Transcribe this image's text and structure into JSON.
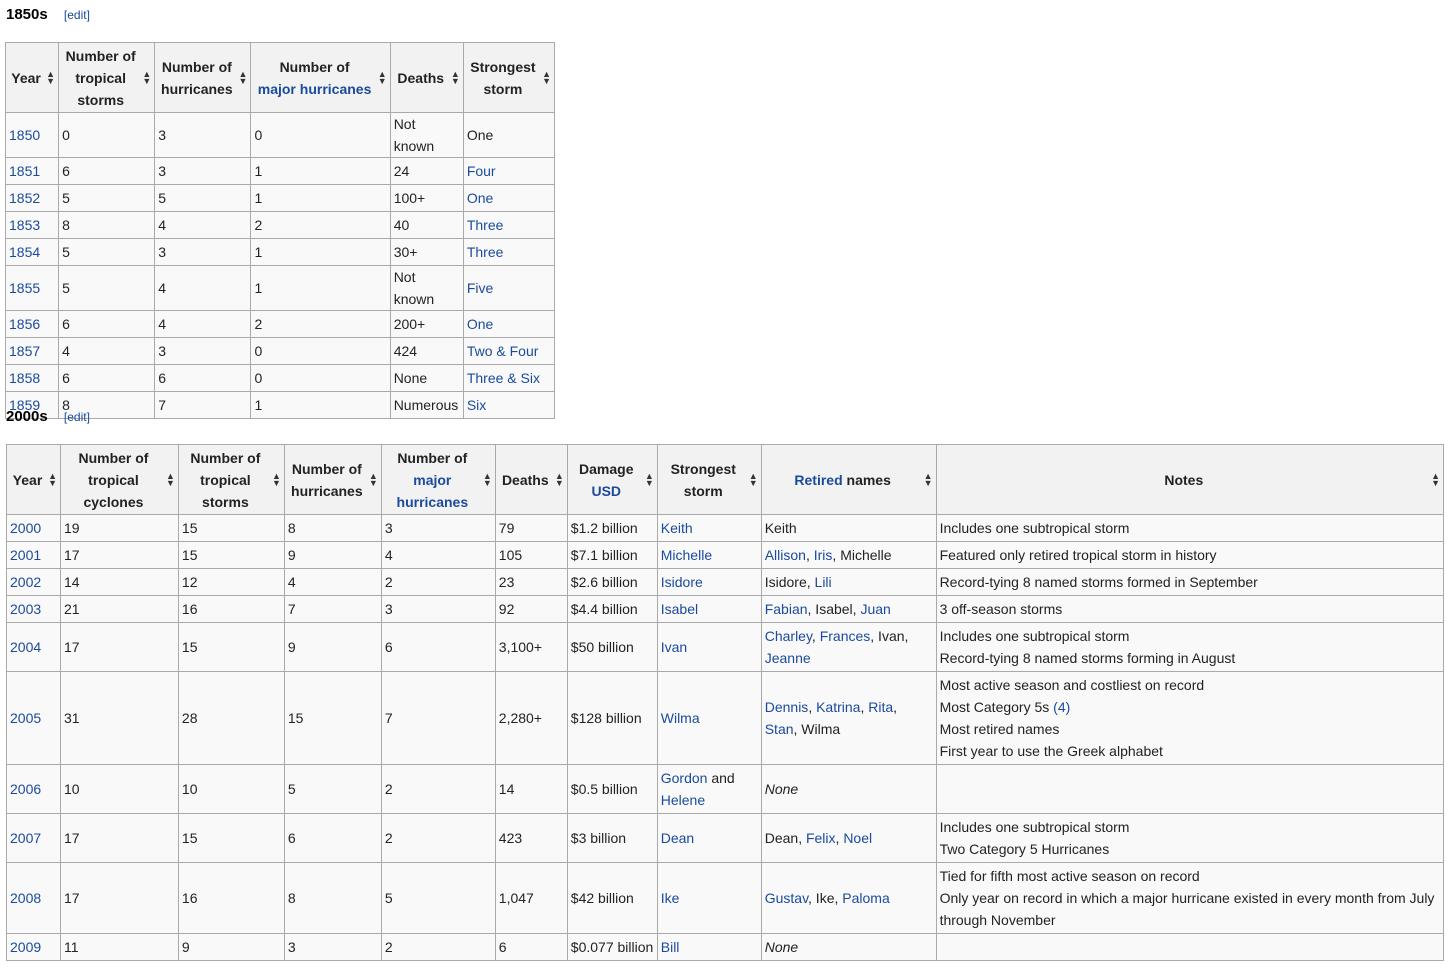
{
  "s1850": {
    "title": "1850s",
    "edit": "[edit]",
    "headers": [
      {
        "text": "Year"
      },
      {
        "text": "Number of tropical storms"
      },
      {
        "text": "Number of hurricanes"
      },
      {
        "pre": "Number of",
        "link": "major hurricanes"
      },
      {
        "text": "Deaths"
      },
      {
        "text": "Strongest storm"
      }
    ],
    "rows": [
      {
        "year": "1850",
        "ts": "0",
        "hu": "3",
        "mh": "0",
        "deaths": "Not known",
        "strongest": "One",
        "strongest_link": false
      },
      {
        "year": "1851",
        "ts": "6",
        "hu": "3",
        "mh": "1",
        "deaths": "24",
        "strongest": "Four",
        "strongest_link": true
      },
      {
        "year": "1852",
        "ts": "5",
        "hu": "5",
        "mh": "1",
        "deaths": "100+",
        "strongest": "One",
        "strongest_link": true
      },
      {
        "year": "1853",
        "ts": "8",
        "hu": "4",
        "mh": "2",
        "deaths": "40",
        "strongest": "Three",
        "strongest_link": true
      },
      {
        "year": "1854",
        "ts": "5",
        "hu": "3",
        "mh": "1",
        "deaths": "30+",
        "strongest": "Three",
        "strongest_link": true
      },
      {
        "year": "1855",
        "ts": "5",
        "hu": "4",
        "mh": "1",
        "deaths": "Not known",
        "strongest": "Five",
        "strongest_link": true
      },
      {
        "year": "1856",
        "ts": "6",
        "hu": "4",
        "mh": "2",
        "deaths": "200+",
        "strongest": "One",
        "strongest_link": true
      },
      {
        "year": "1857",
        "ts": "4",
        "hu": "3",
        "mh": "0",
        "deaths": "424",
        "strongest": "Two & Four",
        "strongest_link": true
      },
      {
        "year": "1858",
        "ts": "6",
        "hu": "6",
        "mh": "0",
        "deaths": "None",
        "strongest": "Three & Six",
        "strongest_link": true
      },
      {
        "year": "1859",
        "ts": "8",
        "hu": "7",
        "mh": "1",
        "deaths": "Numerous",
        "strongest": "Six",
        "strongest_link": true
      }
    ]
  },
  "s2000": {
    "title": "2000s",
    "edit": "[edit]",
    "headers": [
      {
        "text": "Year"
      },
      {
        "text": "Number of tropical cyclones"
      },
      {
        "text": "Number of tropical storms"
      },
      {
        "text": "Number of hurricanes"
      },
      {
        "pre": "Number of",
        "link": "major hurricanes"
      },
      {
        "text": "Deaths"
      },
      {
        "pre": "Damage",
        "link": "USD"
      },
      {
        "text": "Strongest storm"
      },
      {
        "link": "Retired",
        "post": " names"
      },
      {
        "text": "Notes"
      }
    ],
    "rows": [
      {
        "year": "2000",
        "tc": "19",
        "ts": "15",
        "hu": "8",
        "mh": "3",
        "deaths": "79",
        "damage": "$1.2 billion",
        "strongest": [
          {
            "t": "Keith",
            "l": true
          }
        ],
        "retired": [
          {
            "t": "Keith",
            "l": false
          }
        ],
        "notes": [
          "Includes one subtropical storm"
        ]
      },
      {
        "year": "2001",
        "tc": "17",
        "ts": "15",
        "hu": "9",
        "mh": "4",
        "deaths": "105",
        "damage": "$7.1 billion",
        "strongest": [
          {
            "t": "Michelle",
            "l": true
          }
        ],
        "retired": [
          {
            "t": "Allison",
            "l": true
          },
          {
            "t": ", ",
            "l": false
          },
          {
            "t": "Iris",
            "l": true
          },
          {
            "t": ", Michelle",
            "l": false
          }
        ],
        "notes": [
          "Featured only retired tropical storm in history"
        ]
      },
      {
        "year": "2002",
        "tc": "14",
        "ts": "12",
        "hu": "4",
        "mh": "2",
        "deaths": "23",
        "damage": "$2.6 billion",
        "strongest": [
          {
            "t": "Isidore",
            "l": true
          }
        ],
        "retired": [
          {
            "t": "Isidore, ",
            "l": false
          },
          {
            "t": "Lili",
            "l": true
          }
        ],
        "notes": [
          "Record-tying 8 named storms formed in September"
        ]
      },
      {
        "year": "2003",
        "tc": "21",
        "ts": "16",
        "hu": "7",
        "mh": "3",
        "deaths": "92",
        "damage": "$4.4 billion",
        "strongest": [
          {
            "t": "Isabel",
            "l": true
          }
        ],
        "retired": [
          {
            "t": "Fabian",
            "l": true
          },
          {
            "t": ", Isabel, ",
            "l": false
          },
          {
            "t": "Juan",
            "l": true
          }
        ],
        "notes": [
          "3 off-season storms"
        ]
      },
      {
        "year": "2004",
        "tc": "17",
        "ts": "15",
        "hu": "9",
        "mh": "6",
        "deaths": "3,100+",
        "damage": "$50 billion",
        "strongest": [
          {
            "t": "Ivan",
            "l": true
          }
        ],
        "retired": [
          {
            "t": "Charley",
            "l": true
          },
          {
            "t": ", ",
            "l": false
          },
          {
            "t": "Frances",
            "l": true
          },
          {
            "t": ", Ivan, ",
            "l": false
          },
          {
            "t": "Jeanne",
            "l": true
          }
        ],
        "notes": [
          "Includes one subtropical storm",
          "Record-tying 8 named storms forming in August"
        ]
      },
      {
        "year": "2005",
        "tc": "31",
        "ts": "28",
        "hu": "15",
        "mh": "7",
        "deaths": "2,280+",
        "damage": "$128 billion",
        "strongest": [
          {
            "t": "Wilma",
            "l": true
          }
        ],
        "retired": [
          {
            "t": "Dennis",
            "l": true
          },
          {
            "t": ", ",
            "l": false
          },
          {
            "t": "Katrina",
            "l": true
          },
          {
            "t": ", ",
            "l": false
          },
          {
            "t": "Rita",
            "l": true
          },
          {
            "t": ", ",
            "l": false
          },
          {
            "t": "Stan",
            "l": true
          },
          {
            "t": ", Wilma",
            "l": false
          }
        ],
        "notes": [
          "Most active season and costliest on record",
          "Most Category 5s",
          "Most retired names",
          "First year to use the Greek alphabet"
        ],
        "notes_link": {
          "index": 1,
          "text": " (4)"
        }
      },
      {
        "year": "2006",
        "tc": "10",
        "ts": "10",
        "hu": "5",
        "mh": "2",
        "deaths": "14",
        "damage": "$0.5 billion",
        "strongest": [
          {
            "t": "Gordon",
            "l": true
          },
          {
            "t": " and ",
            "l": false
          },
          {
            "t": "Helene",
            "l": true
          }
        ],
        "retired": [
          {
            "t": "None",
            "l": false,
            "i": true
          }
        ],
        "notes": []
      },
      {
        "year": "2007",
        "tc": "17",
        "ts": "15",
        "hu": "6",
        "mh": "2",
        "deaths": "423",
        "damage": "$3 billion",
        "strongest": [
          {
            "t": "Dean",
            "l": true
          }
        ],
        "retired": [
          {
            "t": "Dean, ",
            "l": false
          },
          {
            "t": "Felix",
            "l": true
          },
          {
            "t": ", ",
            "l": false
          },
          {
            "t": "Noel",
            "l": true
          }
        ],
        "notes": [
          "Includes one subtropical storm",
          "Two Category 5 Hurricanes"
        ]
      },
      {
        "year": "2008",
        "tc": "17",
        "ts": "16",
        "hu": "8",
        "mh": "5",
        "deaths": "1,047",
        "damage": "$42 billion",
        "strongest": [
          {
            "t": "Ike",
            "l": true
          }
        ],
        "retired": [
          {
            "t": "Gustav",
            "l": true
          },
          {
            "t": ", Ike, ",
            "l": false
          },
          {
            "t": "Paloma",
            "l": true
          }
        ],
        "notes": [
          "Tied for fifth most active season on record",
          "Only year on record in which a major hurricane existed in every month from July through November"
        ]
      },
      {
        "year": "2009",
        "tc": "11",
        "ts": "9",
        "hu": "3",
        "mh": "2",
        "deaths": "6",
        "damage": "$0.077 billion",
        "strongest": [
          {
            "t": "Bill",
            "l": true
          }
        ],
        "retired": [
          {
            "t": "None",
            "l": false,
            "i": true
          }
        ],
        "notes": []
      }
    ]
  }
}
